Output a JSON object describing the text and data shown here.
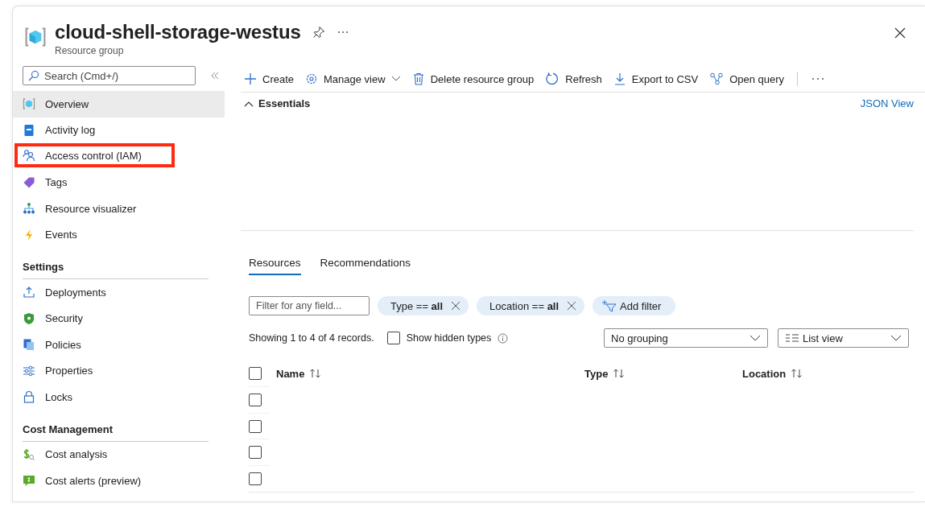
{
  "header": {
    "title": "cloud-shell-storage-westus",
    "subtitle": "Resource group"
  },
  "sidebar": {
    "search": {
      "placeholder": "Search (Cmd+/)"
    },
    "groups": [
      {
        "items": [
          {
            "label": "Overview",
            "kind": "resource-group",
            "selected": true,
            "highlighted": false
          },
          {
            "label": "Activity log",
            "kind": "log",
            "selected": false,
            "highlighted": false
          },
          {
            "label": "Access control (IAM)",
            "kind": "people",
            "selected": false,
            "highlighted": true
          },
          {
            "label": "Tags",
            "kind": "tag",
            "selected": false,
            "highlighted": false
          },
          {
            "label": "Resource visualizer",
            "kind": "hierarchy",
            "selected": false,
            "highlighted": false
          },
          {
            "label": "Events",
            "kind": "bolt",
            "selected": false,
            "highlighted": false
          }
        ]
      },
      {
        "heading": "Settings",
        "items": [
          {
            "label": "Deployments",
            "kind": "upload",
            "selected": false,
            "highlighted": false
          },
          {
            "label": "Security",
            "kind": "shield",
            "selected": false,
            "highlighted": false
          },
          {
            "label": "Policies",
            "kind": "document",
            "selected": false,
            "highlighted": false
          },
          {
            "label": "Properties",
            "kind": "sliders",
            "selected": false,
            "highlighted": false
          },
          {
            "label": "Locks",
            "kind": "lock",
            "selected": false,
            "highlighted": false
          }
        ]
      },
      {
        "heading": "Cost Management",
        "items": [
          {
            "label": "Cost analysis",
            "kind": "dollar-search",
            "selected": false,
            "highlighted": false
          },
          {
            "label": "Cost alerts (preview)",
            "kind": "dollar-alert",
            "selected": false,
            "highlighted": false
          }
        ]
      }
    ]
  },
  "toolbar": [
    {
      "label": "Create",
      "kind": "plus"
    },
    {
      "label": "Manage view",
      "kind": "gear-dropdown"
    },
    {
      "label": "Delete resource group",
      "kind": "trash"
    },
    {
      "label": "Refresh",
      "kind": "refresh"
    },
    {
      "label": "Export to CSV",
      "kind": "download"
    },
    {
      "label": "Open query",
      "kind": "nodes"
    }
  ],
  "essentials": {
    "label": "Essentials",
    "expanded": true,
    "link": "JSON View"
  },
  "tabs": [
    {
      "label": "Resources",
      "selected": true
    },
    {
      "label": "Recommendations",
      "selected": false
    }
  ],
  "filters": {
    "placeholder": "Filter for any field...",
    "pills": [
      "Type == **all**",
      "Location == **all**"
    ],
    "add_filter": "Add filter"
  },
  "records": "Showing 1 to 4 of 4 records.",
  "show_hidden": {
    "label": "Show hidden types",
    "checked": false
  },
  "grouping": {
    "value": "No grouping"
  },
  "view": {
    "value": "List view"
  },
  "table": {
    "select_all": false,
    "columns": [
      "Name",
      "Type",
      "Location"
    ],
    "rows": [
      {
        "checked": false
      },
      {
        "checked": false
      },
      {
        "checked": false
      },
      {
        "checked": false
      }
    ]
  }
}
